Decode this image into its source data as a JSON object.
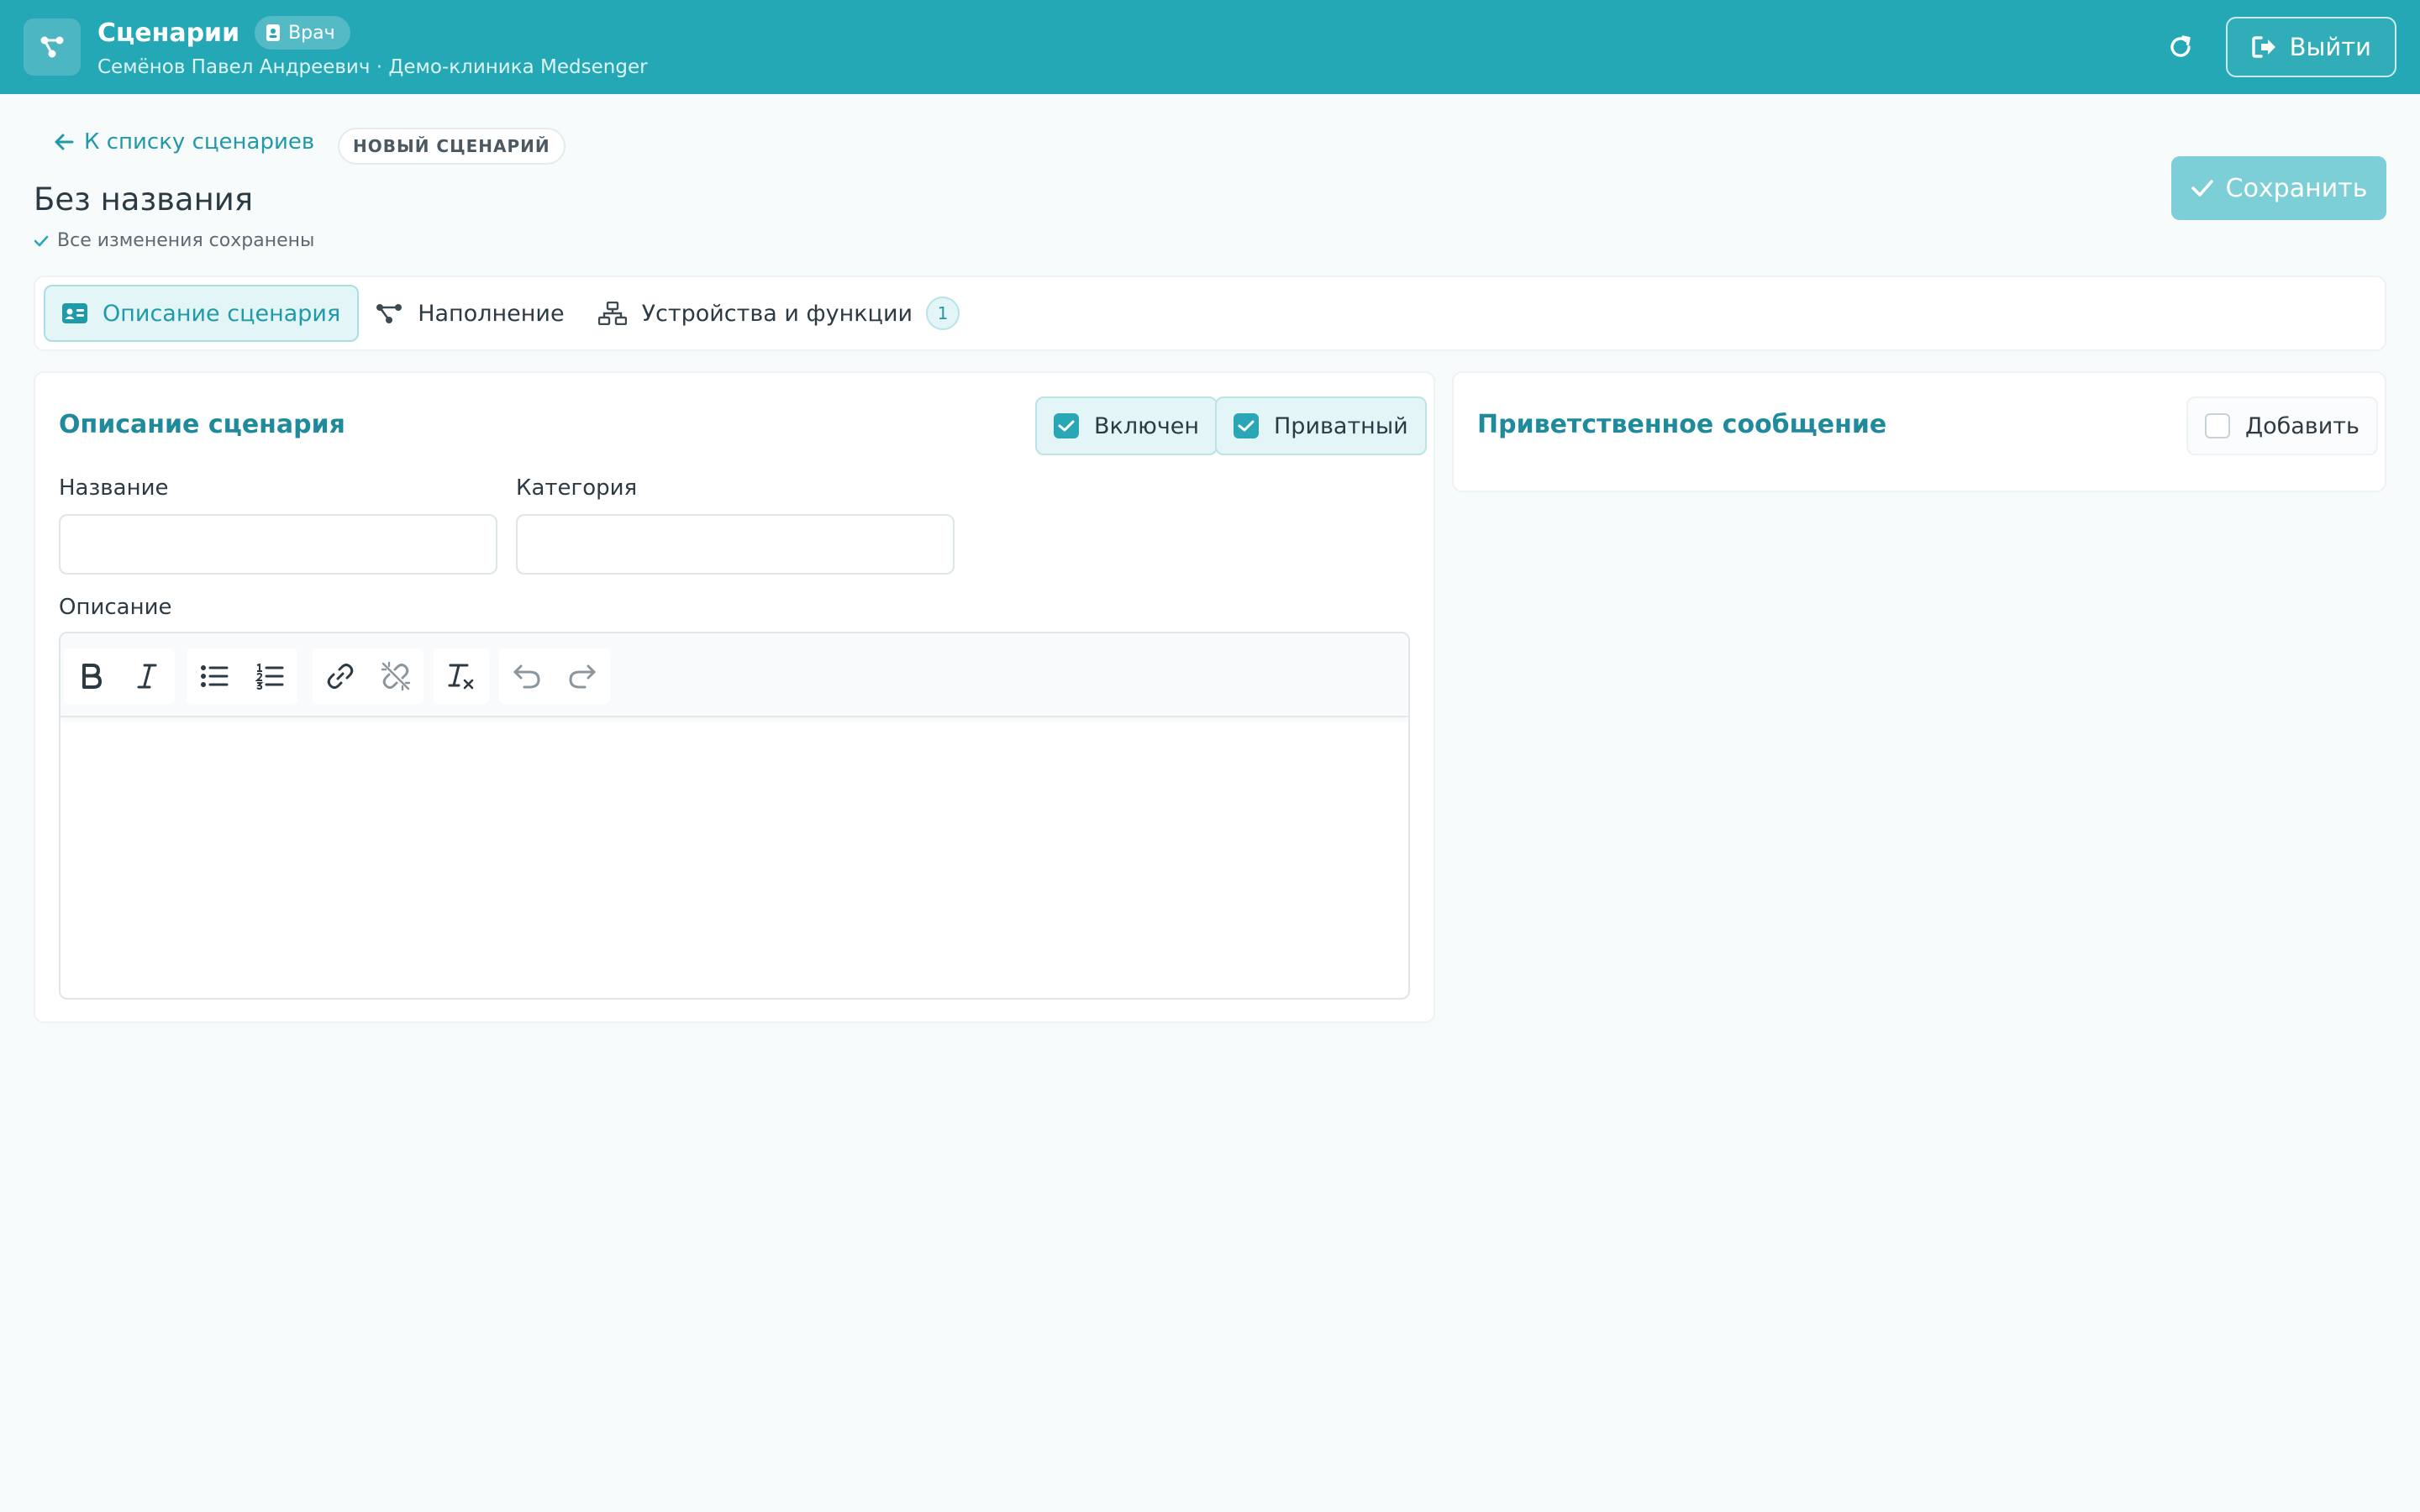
{
  "header": {
    "title": "Сценарии",
    "role_badge": "Врач",
    "subtitle": "Семёнов Павел Андреевич · Демо-клиника Medsenger",
    "logout_label": "Выйти",
    "icons": {
      "logo": "flow-icon",
      "role": "doctor-badge-icon",
      "refresh": "refresh-icon",
      "logout": "logout-icon"
    }
  },
  "page": {
    "back_link": "К списку сценариев",
    "status_badge": "НОВЫЙ СЦЕНАРИЙ",
    "title": "Без названия",
    "save_status": "Все изменения сохранены",
    "save_button": "Сохранить"
  },
  "tabs": [
    {
      "label": "Описание сценария",
      "icon": "id-card-icon",
      "active": true
    },
    {
      "label": "Наполнение",
      "icon": "flow-icon",
      "active": false
    },
    {
      "label": "Устройства и функции",
      "icon": "sitemap-icon",
      "active": false,
      "count": "1"
    }
  ],
  "description_card": {
    "title": "Описание сценария",
    "enabled_label": "Включен",
    "enabled_checked": true,
    "private_label": "Приватный",
    "private_checked": true,
    "name_label": "Название",
    "name_value": "",
    "category_label": "Категория",
    "category_value": "",
    "description_label": "Описание",
    "description_value": "",
    "toolbar": [
      "bold-icon",
      "italic-icon",
      "bullet-list-icon",
      "numbered-list-icon",
      "link-icon",
      "unlink-icon",
      "clear-format-icon",
      "undo-icon",
      "redo-icon"
    ]
  },
  "welcome_card": {
    "title": "Приветственное сообщение",
    "add_label": "Добавить",
    "add_checked": false
  },
  "colors": {
    "header_bg": "#25a8b6",
    "accent": "#1f9aa8",
    "save_button": "#7ccfd7",
    "page_bg": "#f8fbfc"
  }
}
